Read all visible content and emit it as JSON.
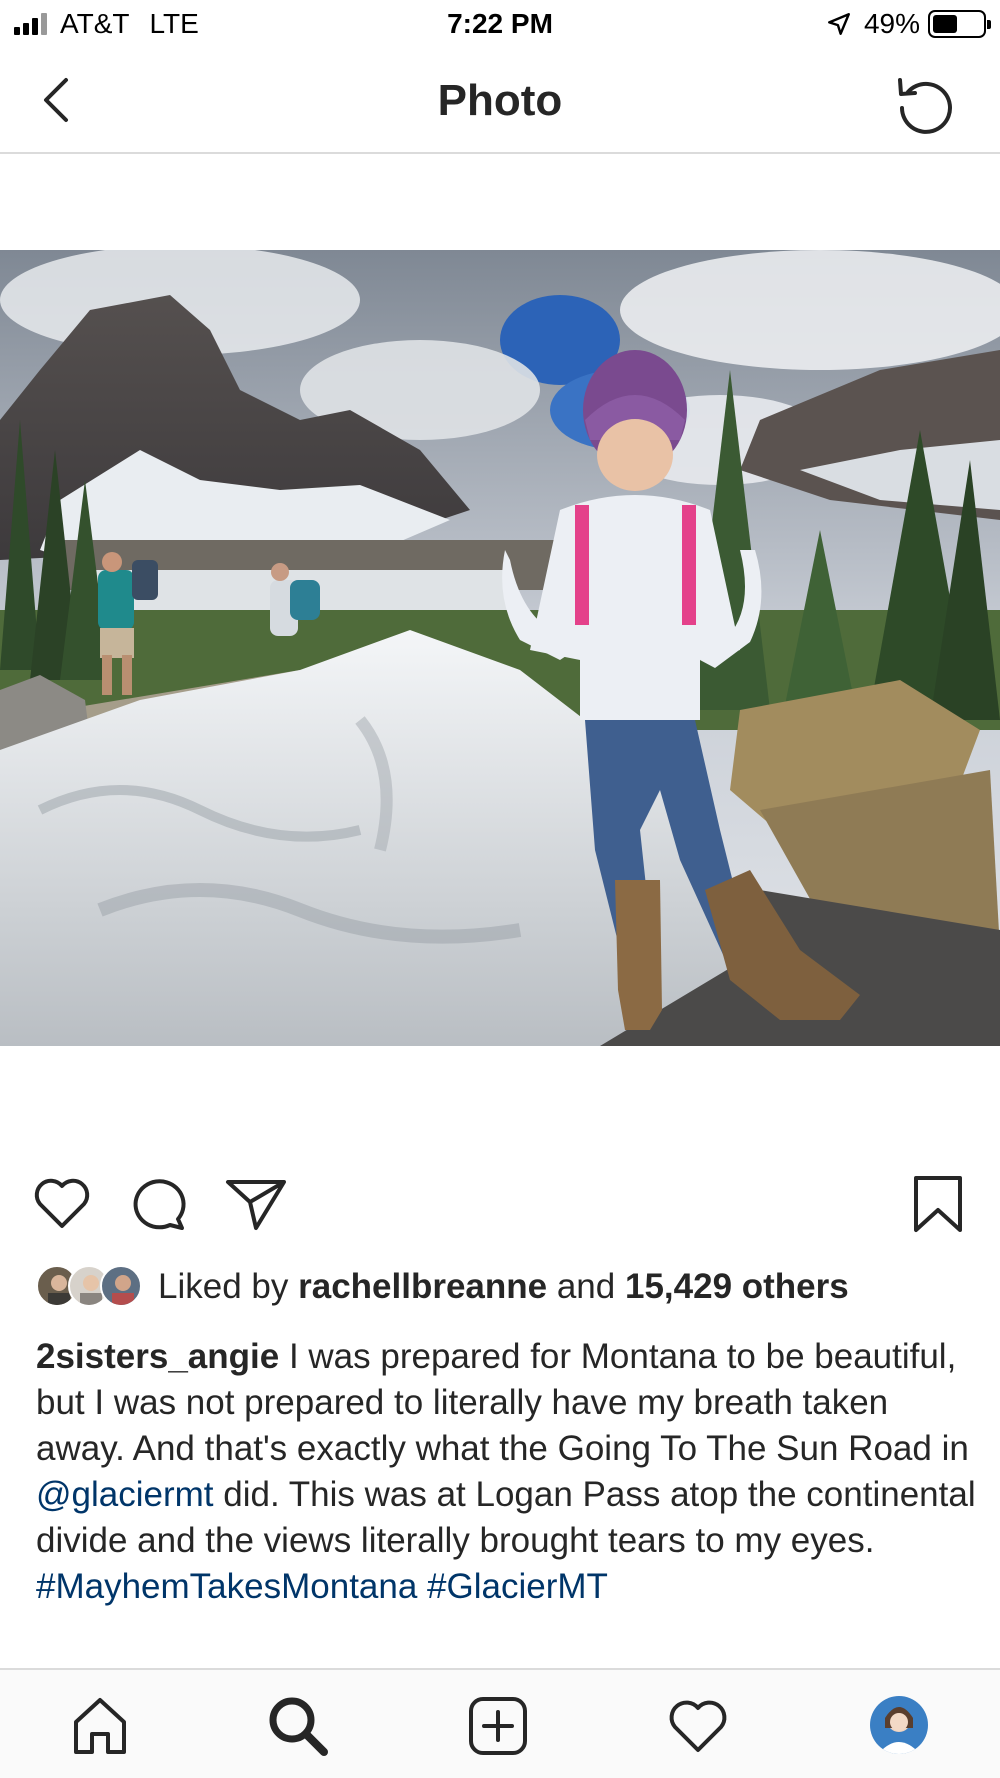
{
  "status_bar": {
    "carrier": "AT&T",
    "network": "LTE",
    "time": "7:22 PM",
    "battery": "49%",
    "battery_level": 0.49
  },
  "header": {
    "title": "Photo",
    "back_icon": "chevron-left-icon",
    "refresh_icon": "refresh-icon"
  },
  "actions": {
    "like_icon": "heart-icon",
    "comment_icon": "comment-icon",
    "share_icon": "send-icon",
    "save_icon": "bookmark-icon"
  },
  "likes": {
    "prefix": "Liked by",
    "user": "rachellbreanne",
    "conjunction": "and",
    "others": "15,429 others"
  },
  "caption": {
    "username": "2sisters_angie",
    "text_1": "I was prepared for Montana to be beautiful, but I was not prepared to literally have my breath taken away. And that's exactly what the Going To The Sun Road in",
    "mention": "@glaciermt",
    "text_2": "did. This was at Logan Pass atop the continental divide and the views literally brought tears to my eyes.",
    "hashtag_1": "#MayhemTakesMontana",
    "hashtag_2": "#GlacierMT"
  },
  "tab_bar": {
    "items": [
      "home-icon",
      "search-icon",
      "add-post-icon",
      "activity-heart-icon",
      "profile-avatar"
    ]
  },
  "colors": {
    "text": "#262626",
    "link": "#003569",
    "divider": "#dbdbdb",
    "tab_bar_bg": "#fafafa"
  }
}
